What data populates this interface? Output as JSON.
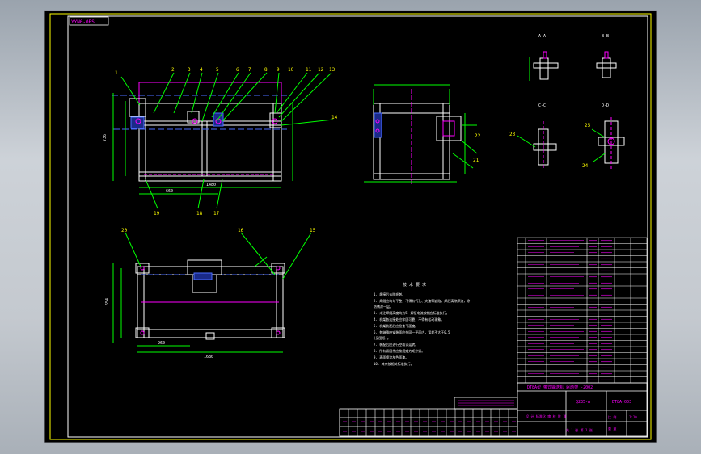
{
  "stamp": "YYN0-0BS",
  "section_labels": {
    "top_left": "A-A",
    "top_right": "B-B",
    "mid_left": "C-C",
    "mid_right": "D-D"
  },
  "callouts_front": [
    "1",
    "2",
    "3",
    "4",
    "5",
    "6",
    "7",
    "8",
    "9",
    "10",
    "11",
    "12",
    "13",
    "14"
  ],
  "callouts_lower": [
    "15",
    "16",
    "17",
    "18",
    "19",
    "20",
    "21",
    "22",
    "23",
    "24",
    "25"
  ],
  "dims": {
    "front_height": "736",
    "front_width_a": "660",
    "front_width_b": "1480",
    "plan_height": "654",
    "plan_width_a": "960",
    "plan_width_b": "1680"
  },
  "notes_title": "技 术 要 求",
  "notes": [
    "1. 焊接后去除毛刺。",
    "2. 焊缝应均匀平整，不得有气孔、夹渣等缺陷，焊后清除焊渣，涂",
    "   防锈漆一层。",
    "3. 未注焊缝高度均为5，焊接电流按相应标准执行。",
    "4. 机架各连接处应牢固可靠，不得有松动现象。",
    "5. 机架装配后应检查平面度。",
    "6. 各轴承座安装面应在同一平面内，误差不大于0.5",
    "   (见图纸)。",
    "7. 装配后应进行空载试运转。",
    "8. 所有紧固件应按规定力矩拧紧。",
    "9. 表面喷涂灰色面漆。",
    "10. 其余按相关标准执行。"
  ],
  "title_block": {
    "title": "DT8A型 带式输送机 驱动架 -2002",
    "material": "Q235-A",
    "drawing_no": "DT8A-003",
    "sheet": "共 1 张 第 1 张",
    "scale": "1:10",
    "designer_row": "设 计  标准化  审 核  批 准",
    "weight_label": "重 量",
    "ratio_label": "比 例"
  },
  "bom": {
    "rows": 24
  },
  "colors": {
    "line_white": "#ffffff",
    "line_magenta": "#ff00ff",
    "line_green": "#00ff00",
    "line_yellow": "#ffff00",
    "line_cyan": "#00ffff",
    "line_blue": "#4a6cff",
    "background": "#000000"
  }
}
